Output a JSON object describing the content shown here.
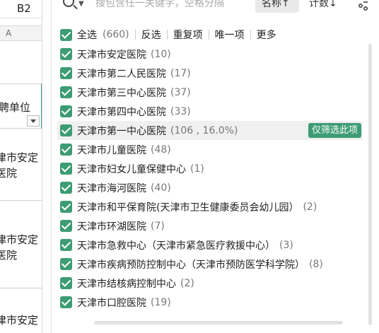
{
  "sheet": {
    "cell_ref": "B2",
    "column_header": "A",
    "header_cell": "聘单位",
    "data_cells": [
      {
        "line1": "津市安定",
        "line2": "医院"
      },
      {
        "line1": "津市安定",
        "line2": "医院"
      },
      {
        "line1": "津市安定",
        "line2": ""
      }
    ]
  },
  "filter": {
    "search_placeholder": "搜包含任一关键字，空格分隔",
    "sort_name_label": "名称↑",
    "sort_count_label": "计数↓",
    "options": {
      "select_all_label": "全选",
      "total_count": "(660)",
      "invert_label": "反选",
      "duplicates_label": "重复项",
      "unique_label": "唯一项",
      "more_label": "更多"
    },
    "only_filter_label": "仅筛选此项",
    "items": [
      {
        "label": "天津市安定医院",
        "count": "(10)"
      },
      {
        "label": "天津市第二人民医院",
        "count": "(17)"
      },
      {
        "label": "天津市第三中心医院",
        "count": "(37)"
      },
      {
        "label": "天津市第四中心医院",
        "count": "(33)"
      },
      {
        "label": "天津市第一中心医院",
        "count": "(106 , 16.0%)"
      },
      {
        "label": "天津市儿童医院",
        "count": "(48)"
      },
      {
        "label": "天津市妇女儿童保健中心",
        "count": "(1)"
      },
      {
        "label": "天津市海河医院",
        "count": "(40)"
      },
      {
        "label": "天津市和平保育院(天津市卫生健康委员会幼儿园）",
        "count": "(2)"
      },
      {
        "label": "天津市环湖医院",
        "count": "(7)"
      },
      {
        "label": "天津市急救中心（天津市紧急医疗救援中心）",
        "count": "(3)"
      },
      {
        "label": "天津市疾病预防控制中心（天津市预防医学科学院）",
        "count": "(8)"
      },
      {
        "label": "天津市结核病控制中心",
        "count": "(2)"
      },
      {
        "label": "天津市口腔医院",
        "count": "(19)"
      }
    ]
  },
  "colors": {
    "accent": "#3d9c73",
    "highlight_row": "#f0f0f0"
  }
}
